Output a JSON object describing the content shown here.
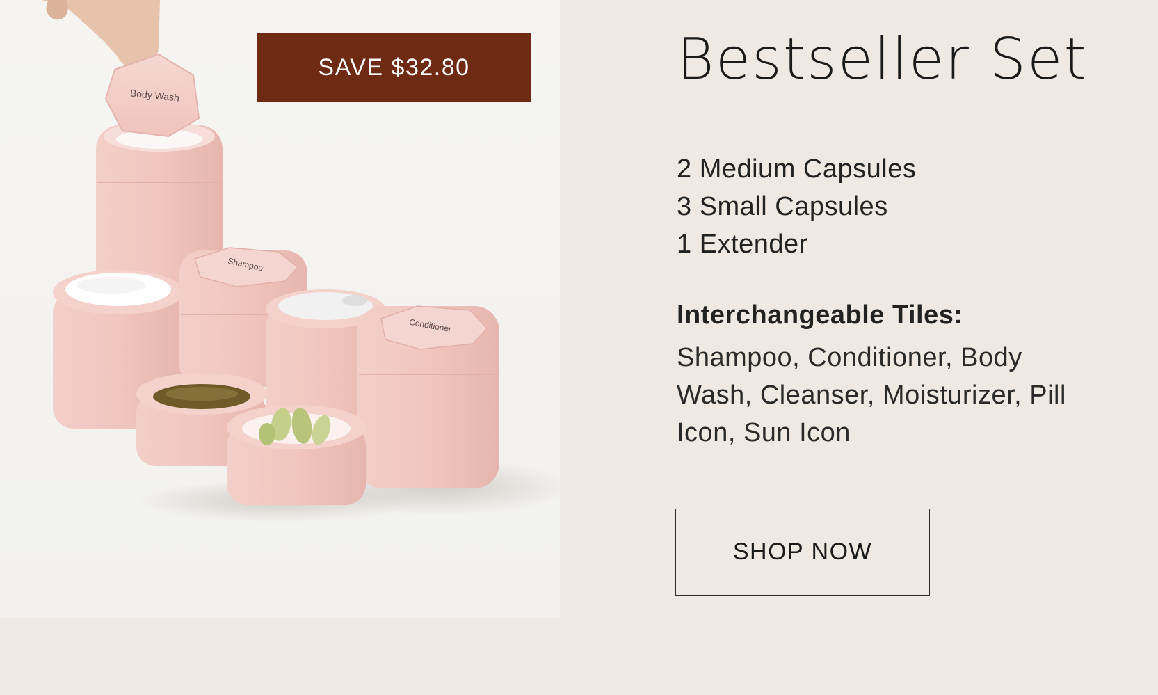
{
  "promo": {
    "badge_text": "SAVE $32.80",
    "badge_color": "#6e2a13"
  },
  "product": {
    "title": "Bestseller Set",
    "contents": [
      "2 Medium Capsules",
      "3 Small Capsules",
      "1 Extender"
    ],
    "tiles_heading": "Interchangeable Tiles:",
    "tiles_list": "Shampoo, Conditioner, Body Wash, Cleanser, Moisturizer, Pill Icon, Sun Icon",
    "image_labels": {
      "tile_in_hand": "Body Wash",
      "capsule_shampoo": "Shampoo",
      "capsule_conditioner": "Conditioner"
    },
    "capsule_color": "#f0c9c3"
  },
  "cta": {
    "label": "SHOP NOW"
  },
  "colors": {
    "background": "#eee9e3",
    "text": "#1e1e1e"
  }
}
